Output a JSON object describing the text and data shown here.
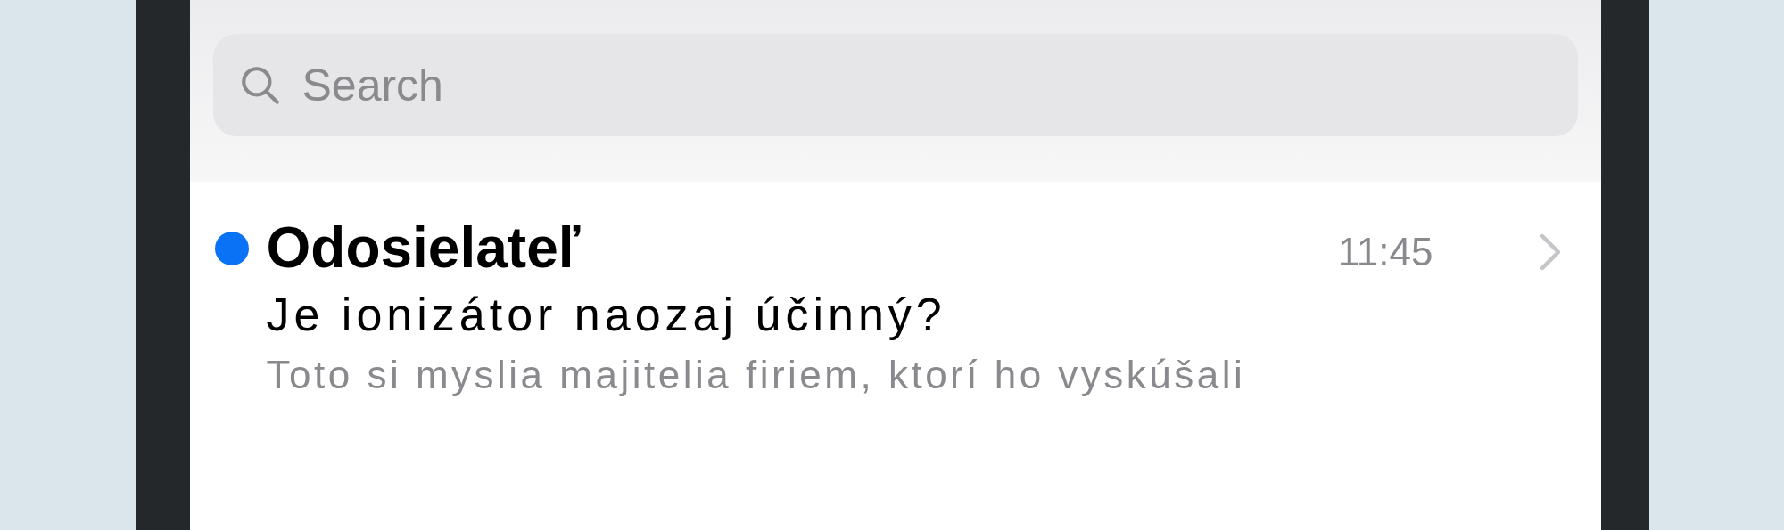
{
  "search": {
    "placeholder": "Search"
  },
  "messages": [
    {
      "unread": true,
      "sender": "Odosielateľ",
      "time": "11:45",
      "subject": "Je ionizátor naozaj účinný?",
      "preview": "Toto si myslia majitelia firiem, ktorí ho vyskúšali"
    }
  ]
}
